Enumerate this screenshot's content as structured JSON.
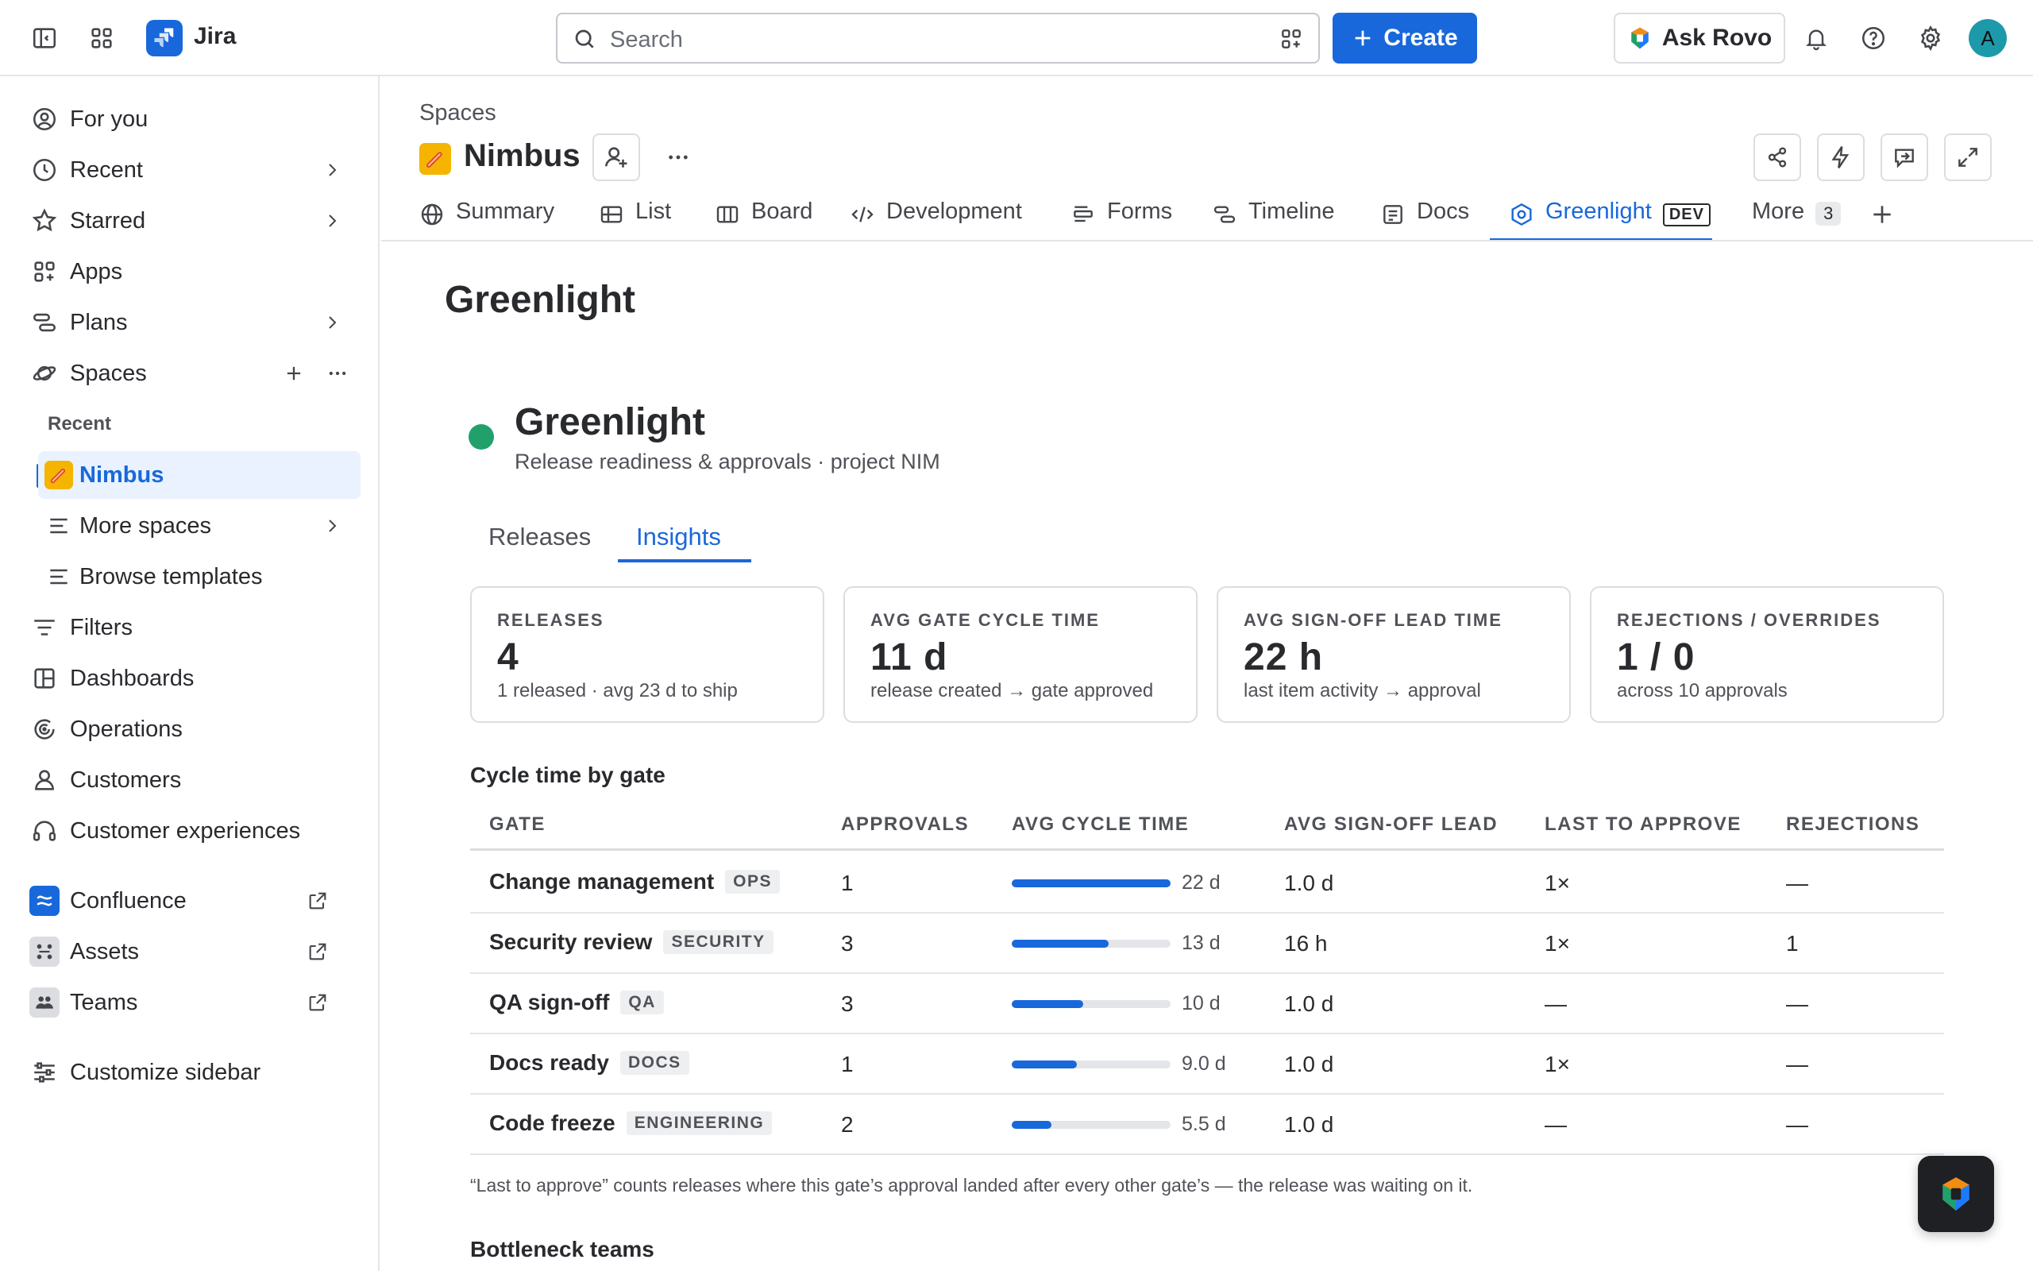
{
  "topbar": {
    "app_name": "Jira",
    "search_placeholder": "Search",
    "create_label": "Create",
    "ask_rovo_label": "Ask Rovo",
    "avatar_initial": "A",
    "icons": [
      "sidebar-toggle-icon",
      "app-switcher-icon",
      "search-icon",
      "filter-icon",
      "bell-icon",
      "help-icon",
      "settings-icon"
    ]
  },
  "sidebar": {
    "items": [
      {
        "label": "For you",
        "icon": "person-circle-icon"
      },
      {
        "label": "Recent",
        "icon": "clock-icon"
      },
      {
        "label": "Starred",
        "icon": "star-icon"
      },
      {
        "label": "Apps",
        "icon": "apps-icon"
      },
      {
        "label": "Plans",
        "icon": "plans-icon"
      },
      {
        "label": "Spaces",
        "icon": "spaces-icon"
      }
    ],
    "recent_label": "Recent",
    "spaces": {
      "active": "Nimbus",
      "more": "More spaces",
      "browse": "Browse templates"
    },
    "bottom_items": [
      {
        "label": "Filters",
        "icon": "filter-lines-icon"
      },
      {
        "label": "Dashboards",
        "icon": "dashboard-icon"
      },
      {
        "label": "Operations",
        "icon": "operations-icon"
      },
      {
        "label": "Customers",
        "icon": "person-icon"
      },
      {
        "label": "Customer experiences",
        "icon": "headset-icon"
      }
    ],
    "apps": [
      {
        "label": "Confluence",
        "icon": "confluence-icon"
      },
      {
        "label": "Assets",
        "icon": "assets-icon"
      },
      {
        "label": "Teams",
        "icon": "teams-icon"
      }
    ],
    "customize": "Customize sidebar"
  },
  "space": {
    "breadcrumb": "Spaces",
    "title": "Nimbus",
    "tabs": [
      {
        "label": "Summary",
        "icon": "globe-icon"
      },
      {
        "label": "List",
        "icon": "list-icon"
      },
      {
        "label": "Board",
        "icon": "board-icon"
      },
      {
        "label": "Development",
        "icon": "code-icon"
      },
      {
        "label": "Forms",
        "icon": "forms-icon"
      },
      {
        "label": "Timeline",
        "icon": "timeline-icon"
      },
      {
        "label": "Docs",
        "icon": "docs-icon"
      },
      {
        "label": "Greenlight",
        "icon": "greenlight-icon",
        "badge": "DEV",
        "active": true
      },
      {
        "label": "More",
        "count": "3"
      }
    ]
  },
  "page": {
    "heading": "Greenlight",
    "app_title": "Greenlight",
    "app_subtitle": "Release readiness & approvals · project NIM",
    "status_color": "#22A06B",
    "inner_tabs": [
      "Releases",
      "Insights"
    ],
    "active_inner_tab": "Insights"
  },
  "stats": [
    {
      "label": "RELEASES",
      "value": "4",
      "sub": "1 released · avg 23 d to ship"
    },
    {
      "label": "AVG GATE CYCLE TIME",
      "value": "11 d",
      "sub": "release created → gate approved"
    },
    {
      "label": "AVG SIGN-OFF LEAD TIME",
      "value": "22 h",
      "sub": "last item activity → approval"
    },
    {
      "label": "REJECTIONS / OVERRIDES",
      "value": "1 / 0",
      "sub": "across 10 approvals"
    }
  ],
  "cycle_table": {
    "title": "Cycle time by gate",
    "headers": [
      "GATE",
      "APPROVALS",
      "AVG CYCLE TIME",
      "AVG SIGN-OFF LEAD",
      "LAST TO APPROVE",
      "REJECTIONS"
    ],
    "rows": [
      {
        "gate": "Change management",
        "tag": "OPS",
        "approvals": "1",
        "cycle": "22 d",
        "cycle_fraction": 1.0,
        "lead": "1.0 d",
        "last": "1×",
        "rejections": "—"
      },
      {
        "gate": "Security review",
        "tag": "SECURITY",
        "approvals": "3",
        "cycle": "13 d",
        "cycle_fraction": 0.61,
        "lead": "16 h",
        "last": "1×",
        "rejections": "1"
      },
      {
        "gate": "QA sign-off",
        "tag": "QA",
        "approvals": "3",
        "cycle": "10 d",
        "cycle_fraction": 0.45,
        "lead": "1.0 d",
        "last": "—",
        "rejections": "—"
      },
      {
        "gate": "Docs ready",
        "tag": "DOCS",
        "approvals": "1",
        "cycle": "9.0 d",
        "cycle_fraction": 0.41,
        "lead": "1.0 d",
        "last": "1×",
        "rejections": "—"
      },
      {
        "gate": "Code freeze",
        "tag": "ENGINEERING",
        "approvals": "2",
        "cycle": "5.5 d",
        "cycle_fraction": 0.25,
        "lead": "1.0 d",
        "last": "—",
        "rejections": "—"
      }
    ],
    "footnote": "“Last to approve” counts releases where this gate’s approval landed after every other gate’s — the release was waiting on it."
  },
  "bottleneck_title": "Bottleneck teams"
}
